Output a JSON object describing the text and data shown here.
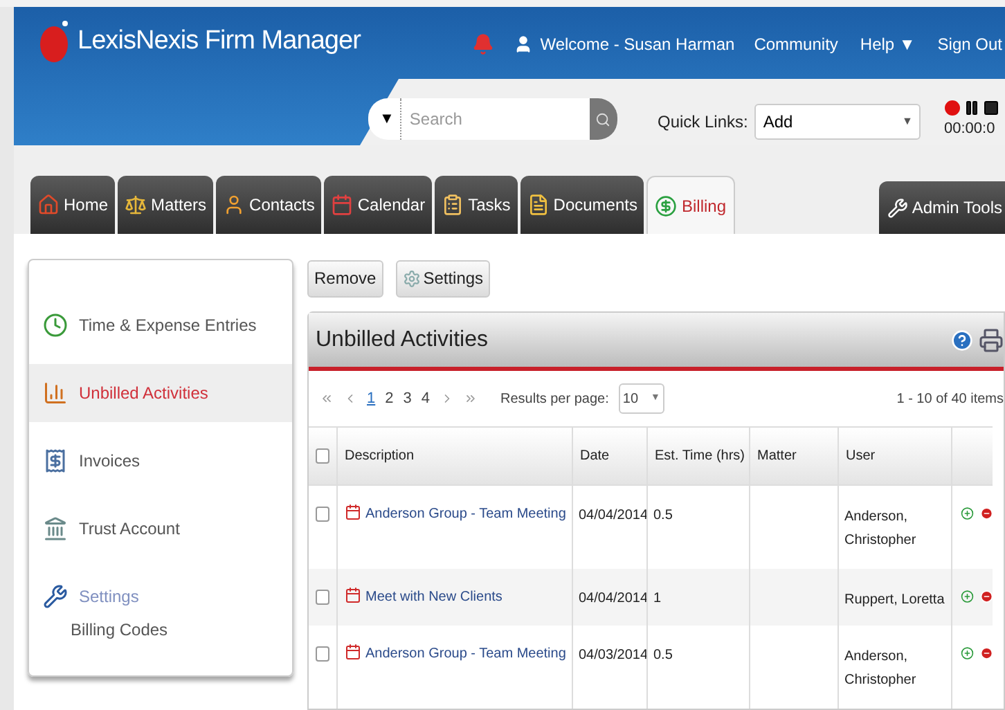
{
  "brand": {
    "name": "LexisNexis Firm Manager"
  },
  "user_menu": {
    "welcome": "Welcome - Susan Harman",
    "links": [
      "Community",
      "Help ▼",
      "Sign Out"
    ]
  },
  "search": {
    "scope": "▼",
    "placeholder": "Search"
  },
  "quick_links": {
    "label": "Quick Links:",
    "value": "Add",
    "caret": "▼"
  },
  "timer": {
    "time": "00:00:0"
  },
  "tabs": [
    {
      "label": "Home",
      "selected": false
    },
    {
      "label": "Matters",
      "selected": false
    },
    {
      "label": "Contacts",
      "selected": false
    },
    {
      "label": "Calendar",
      "selected": false
    },
    {
      "label": "Tasks",
      "selected": false
    },
    {
      "label": "Documents",
      "selected": false
    },
    {
      "label": "Billing",
      "selected": true
    }
  ],
  "admin_tab": {
    "label": "Admin Tools"
  },
  "sidebar": {
    "items": [
      {
        "label": "Time & Expense Entries",
        "selected": false
      },
      {
        "label": "Unbilled Activities",
        "selected": true
      },
      {
        "label": "Invoices",
        "selected": false
      },
      {
        "label": "Trust Account",
        "selected": false
      },
      {
        "label": "Settings",
        "selected": false,
        "children": [
          {
            "label": "Billing Codes",
            "selected": false
          }
        ]
      }
    ]
  },
  "toolbar": {
    "buttons": [
      {
        "label": "Remove",
        "kind": "plain"
      },
      {
        "label": "Settings",
        "kind": "gear"
      }
    ]
  },
  "panel": {
    "title": "Unbilled Activities"
  },
  "pager": {
    "pages": [
      {
        "label": "1",
        "selected": true
      },
      {
        "label": "2",
        "selected": false
      },
      {
        "label": "3",
        "selected": false
      },
      {
        "label": "4",
        "selected": false
      }
    ],
    "per_page_label": "Results per page:",
    "per_page": "10",
    "caret": "▼",
    "summary": "1 - 10 of 40 items"
  },
  "table": {
    "select_all_checked": false,
    "columns": [
      "Description",
      "Date",
      "Est. Time (hrs)",
      "Matter",
      "User"
    ],
    "rows": [
      {
        "checked": false,
        "description": "Anderson Group - Team Meeting",
        "date": "04/04/2014",
        "est_time": "0.5",
        "user": "Anderson, Christopher"
      },
      {
        "checked": false,
        "description": "Meet with New Clients",
        "date": "04/04/2014",
        "est_time": "1",
        "user": "Ruppert, Loretta"
      },
      {
        "checked": false,
        "description": "Anderson Group - Team Meeting",
        "date": "04/03/2014",
        "est_time": "0.5",
        "user": "Anderson, Christopher"
      }
    ]
  }
}
